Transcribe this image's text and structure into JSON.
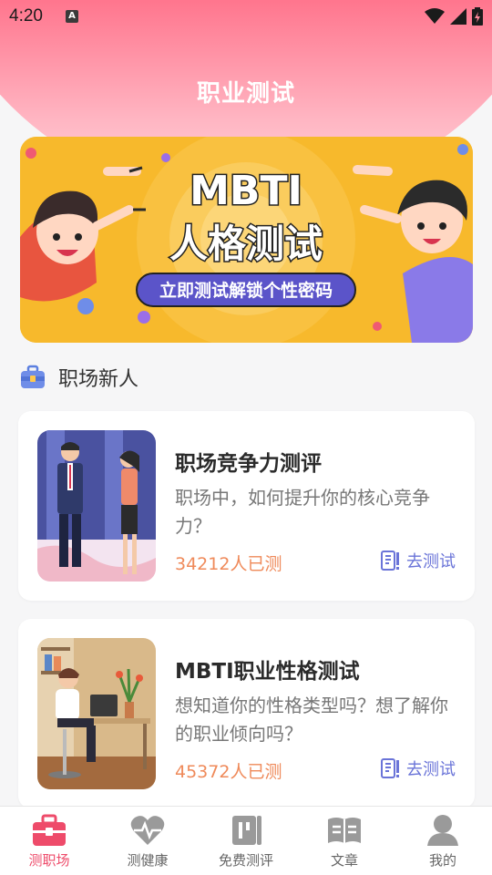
{
  "status_bar": {
    "time": "4:20"
  },
  "header": {
    "title": "职业测试"
  },
  "banner": {
    "headline": "MBTI",
    "subline": "人格测试",
    "tagline": "立即测试解锁个性密码"
  },
  "section": {
    "title": "职场新人"
  },
  "cards": [
    {
      "title": "职场竞争力测评",
      "desc": "职场中，如何提升你的核心竞争力？",
      "count": "34212人已测",
      "action": "去测试"
    },
    {
      "title": "MBTI职业性格测试",
      "desc": "想知道你的性格类型吗？想了解你的职业倾向吗？",
      "count": "45372人已测",
      "action": "去测试"
    }
  ],
  "tabs": [
    {
      "label": "测职场",
      "icon": "briefcase-icon",
      "active": true
    },
    {
      "label": "测健康",
      "icon": "heartbeat-icon",
      "active": false
    },
    {
      "label": "免费测评",
      "icon": "clipboard-icon",
      "active": false
    },
    {
      "label": "文章",
      "icon": "open-book-icon",
      "active": false
    },
    {
      "label": "我的",
      "icon": "user-icon",
      "active": false
    }
  ],
  "colors": {
    "accent": "#ee4b6a",
    "header": "#ff6a84",
    "banner": "#f7b92c",
    "link": "#6a74d8",
    "count": "#ef8a5a",
    "tab_inactive": "#9a9a9a"
  }
}
